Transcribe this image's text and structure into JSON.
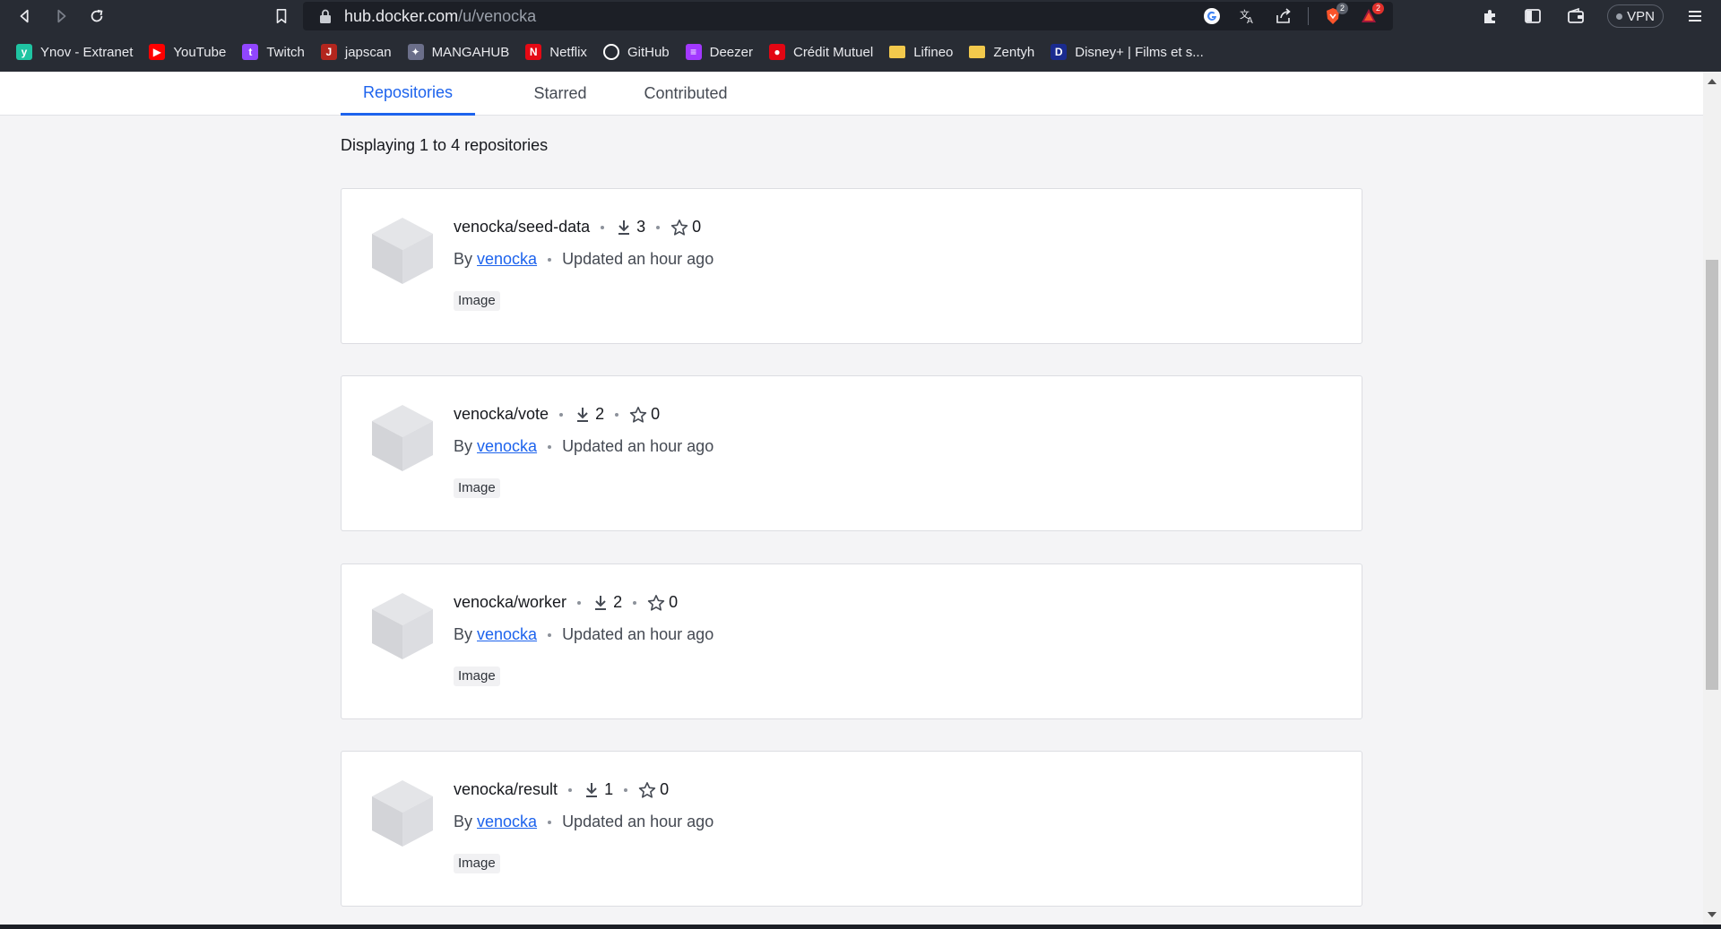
{
  "browser": {
    "url_host": "hub.docker.com",
    "url_path": "/u/venocka",
    "brave_badge": "2",
    "alert_badge": "2",
    "vpn_label": "VPN"
  },
  "bookmarks": [
    {
      "label": "Ynov - Extranet",
      "icon": "ynov-icon",
      "color": "#1fc4a2",
      "glyph": "y"
    },
    {
      "label": "YouTube",
      "icon": "youtube-icon",
      "color": "#ff0000",
      "glyph": "▶"
    },
    {
      "label": "Twitch",
      "icon": "twitch-icon",
      "color": "#9146ff",
      "glyph": "t"
    },
    {
      "label": "japscan",
      "icon": "japscan-icon",
      "color": "#b3261e",
      "glyph": "J"
    },
    {
      "label": "MANGAHUB",
      "icon": "mangahub-icon",
      "color": "#6b6f8a",
      "glyph": "✦"
    },
    {
      "label": "Netflix",
      "icon": "netflix-icon",
      "color": "#e50914",
      "glyph": "N"
    },
    {
      "label": "GitHub",
      "icon": "github-icon",
      "color": "#ffffff",
      "glyph": "●"
    },
    {
      "label": "Deezer",
      "icon": "deezer-icon",
      "color": "#a238ff",
      "glyph": "≡"
    },
    {
      "label": "Crédit Mutuel",
      "icon": "credit-mutuel-icon",
      "color": "#e30613",
      "glyph": "●"
    },
    {
      "label": "Lifineo",
      "icon": "folder-icon",
      "color": "#f2c94c",
      "glyph": ""
    },
    {
      "label": "Zentyh",
      "icon": "folder-icon",
      "color": "#f2c94c",
      "glyph": ""
    },
    {
      "label": "Disney+ | Films et s...",
      "icon": "disney-icon",
      "color": "#1a2b8f",
      "glyph": "D"
    }
  ],
  "tabs": [
    {
      "label": "Repositories",
      "active": true
    },
    {
      "label": "Starred",
      "active": false
    },
    {
      "label": "Contributed",
      "active": false
    }
  ],
  "display_count": "Displaying 1 to 4 repositories",
  "repositories": [
    {
      "name": "venocka/seed-data",
      "pulls": "3",
      "stars": "0",
      "by": "By",
      "owner": "venocka",
      "updated": "Updated an hour ago",
      "type": "Image"
    },
    {
      "name": "venocka/vote",
      "pulls": "2",
      "stars": "0",
      "by": "By",
      "owner": "venocka",
      "updated": "Updated an hour ago",
      "type": "Image"
    },
    {
      "name": "venocka/worker",
      "pulls": "2",
      "stars": "0",
      "by": "By",
      "owner": "venocka",
      "updated": "Updated an hour ago",
      "type": "Image"
    },
    {
      "name": "venocka/result",
      "pulls": "1",
      "stars": "0",
      "by": "By",
      "owner": "venocka",
      "updated": "Updated an hour ago",
      "type": "Image"
    }
  ]
}
